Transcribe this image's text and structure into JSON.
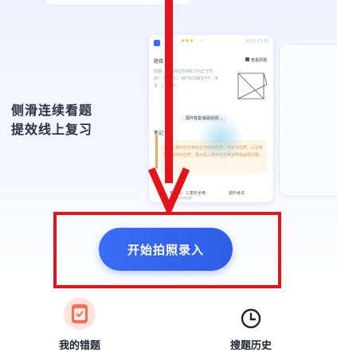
{
  "hero": {
    "slogan_line1": "侧滑连续看题",
    "slogan_line2": "提效线上复习"
  },
  "preview_card": {
    "date": "2023.03.28",
    "question_label": "题目",
    "library_label": "查看原题",
    "question_text": "如图，已知四边形ABCD为正方形，AC、AE=AC，AE与CD相交于F，求证：CE=CF。",
    "expand_label": "展开答案/解题视频",
    "notes_label": "笔记",
    "notes_text": "考查三角形的全等和正方形的性质，判定与性质。以及等腰三角形的性质。重点是三角形的全等证明是解题关键。",
    "footer_left": "知识点：三角形全等",
    "footer_right": "期中考试",
    "footer_sub": "来源：中考数学模拟题"
  },
  "start_button": {
    "label": "开始拍照录入"
  },
  "tabs": [
    {
      "label": "我的错题",
      "icon": "wrongbook-icon"
    },
    {
      "label": "搜题历史",
      "icon": "clock-icon"
    }
  ],
  "colors": {
    "accent": "#2f5ee6",
    "highlight_frame": "#e5141b",
    "arrow": "#e5141b"
  }
}
